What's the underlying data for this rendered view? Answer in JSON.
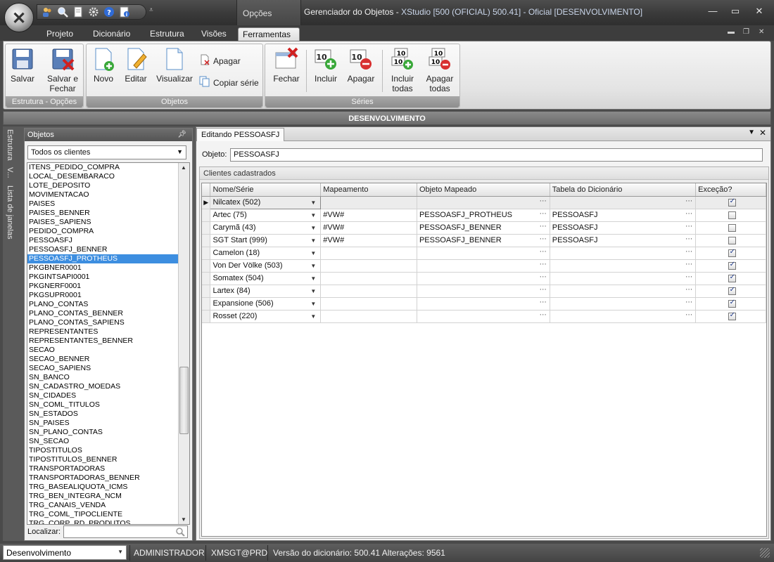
{
  "window": {
    "title_prefix": "Gerenciador do Objetos - ",
    "title_rest": "XStudio [500 (OFICIAL) 500.41] - Oficial [DESENVOLVIMENTO]",
    "contextual_group": "Opções"
  },
  "quick_access": [
    "users-icon",
    "search-icon",
    "document-icon",
    "gear-icon",
    "help-icon",
    "info-icon"
  ],
  "ribbon_tabs": [
    {
      "label": "Projeto"
    },
    {
      "label": "Dicionário"
    },
    {
      "label": "Estrutura"
    },
    {
      "label": "Visões"
    },
    {
      "label": "Ferramentas",
      "active": true
    }
  ],
  "ribbon": {
    "groups": {
      "estrutura": "Estrutura - Opções",
      "objetos": "Objetos",
      "series": "Séries"
    },
    "buttons": {
      "salvar": "Salvar",
      "salvar_fechar_1": "Salvar e",
      "salvar_fechar_2": "Fechar",
      "novo": "Novo",
      "editar": "Editar",
      "visualizar": "Visualizar",
      "apagar": "Apagar",
      "copiar_serie": "Copiar série",
      "fechar": "Fechar",
      "incluir": "Incluir",
      "apagar_serie": "Apagar",
      "incluir_todas_1": "Incluir",
      "incluir_todas_2": "todas",
      "apagar_todas_1": "Apagar",
      "apagar_todas_2": "todas"
    }
  },
  "banner": "DESENVOLVIMENTO",
  "side_tabs": [
    "Estrutura",
    "V...",
    "Lista de janelas"
  ],
  "objetos_panel": {
    "title": "Objetos",
    "filter_value": "Todos os clientes",
    "items": [
      "ITENS_PEDIDO_COMPRA",
      "LOCAL_DESEMBARACO",
      "LOTE_DEPOSITO",
      "MOVIMENTACAO",
      "PAISES",
      "PAISES_BENNER",
      "PAISES_SAPIENS",
      "PEDIDO_COMPRA",
      "PESSOASFJ",
      "PESSOASFJ_BENNER",
      "PESSOASFJ_PROTHEUS",
      "PKGBNER0001",
      "PKGINTSAPI0001",
      "PKGNERF0001",
      "PKGSUPR0001",
      "PLANO_CONTAS",
      "PLANO_CONTAS_BENNER",
      "PLANO_CONTAS_SAPIENS",
      "REPRESENTANTES",
      "REPRESENTANTES_BENNER",
      "SECAO",
      "SECAO_BENNER",
      "SECAO_SAPIENS",
      "SN_BANCO",
      "SN_CADASTRO_MOEDAS",
      "SN_CIDADES",
      "SN_COML_TITULOS",
      "SN_ESTADOS",
      "SN_PAISES",
      "SN_PLANO_CONTAS",
      "SN_SECAO",
      "TIPOSTITULOS",
      "TIPOSTITULOS_BENNER",
      "TRANSPORTADORAS",
      "TRANSPORTADORAS_BENNER",
      "TRG_BASEALIQUOTA_ICMS",
      "TRG_BEN_INTEGRA_NCM",
      "TRG_CANAIS_VENDA",
      "TRG_COML_TIPOCLIENTE",
      "TRG_CORP_RD_PRODUTOS"
    ],
    "selected": "PESSOASFJ_PROTHEUS",
    "localizar_label": "Localizar:"
  },
  "editor": {
    "tab_label": "Editando PESSOASFJ",
    "objeto_label": "Objeto:",
    "objeto_value": "PESSOASFJ",
    "section_title": "Clientes cadastrados",
    "columns": [
      "Nome/Série",
      "Mapeamento",
      "Objeto Mapeado",
      "Tabela do Dicionário",
      "Exceção?"
    ],
    "rows": [
      {
        "name": "Nilcatex (502)",
        "map": "",
        "obj": "",
        "tab": "",
        "exc": true,
        "current": true
      },
      {
        "name": "Artec (75)",
        "map": "#VW#",
        "obj": "PESSOASFJ_PROTHEUS",
        "tab": "PESSOASFJ",
        "exc": false
      },
      {
        "name": "Carymã (43)",
        "map": "#VW#",
        "obj": "PESSOASFJ_BENNER",
        "tab": "PESSOASFJ",
        "exc": false
      },
      {
        "name": "SGT Start (999)",
        "map": "#VW#",
        "obj": "PESSOASFJ_BENNER",
        "tab": "PESSOASFJ",
        "exc": false
      },
      {
        "name": "Camelon (18)",
        "map": "",
        "obj": "",
        "tab": "",
        "exc": true
      },
      {
        "name": "Von Der Völke (503)",
        "map": "",
        "obj": "",
        "tab": "",
        "exc": true
      },
      {
        "name": "Somatex (504)",
        "map": "",
        "obj": "",
        "tab": "",
        "exc": true
      },
      {
        "name": "Lartex (84)",
        "map": "",
        "obj": "",
        "tab": "",
        "exc": true
      },
      {
        "name": "Expansione (506)",
        "map": "",
        "obj": "",
        "tab": "",
        "exc": true
      },
      {
        "name": "Rosset (220)",
        "map": "",
        "obj": "",
        "tab": "",
        "exc": true
      }
    ]
  },
  "status": {
    "environment": "Desenvolvimento",
    "user": "ADMINISTRADOR",
    "connection": "XMSGT@PRD",
    "version": "Versão do dicionário: 500.41 Alterações: 9561"
  },
  "colors": {
    "selection": "#3d8ee0",
    "chrome_dark": "#3d3d3d",
    "ribbon_label": "#8d8d8d"
  }
}
